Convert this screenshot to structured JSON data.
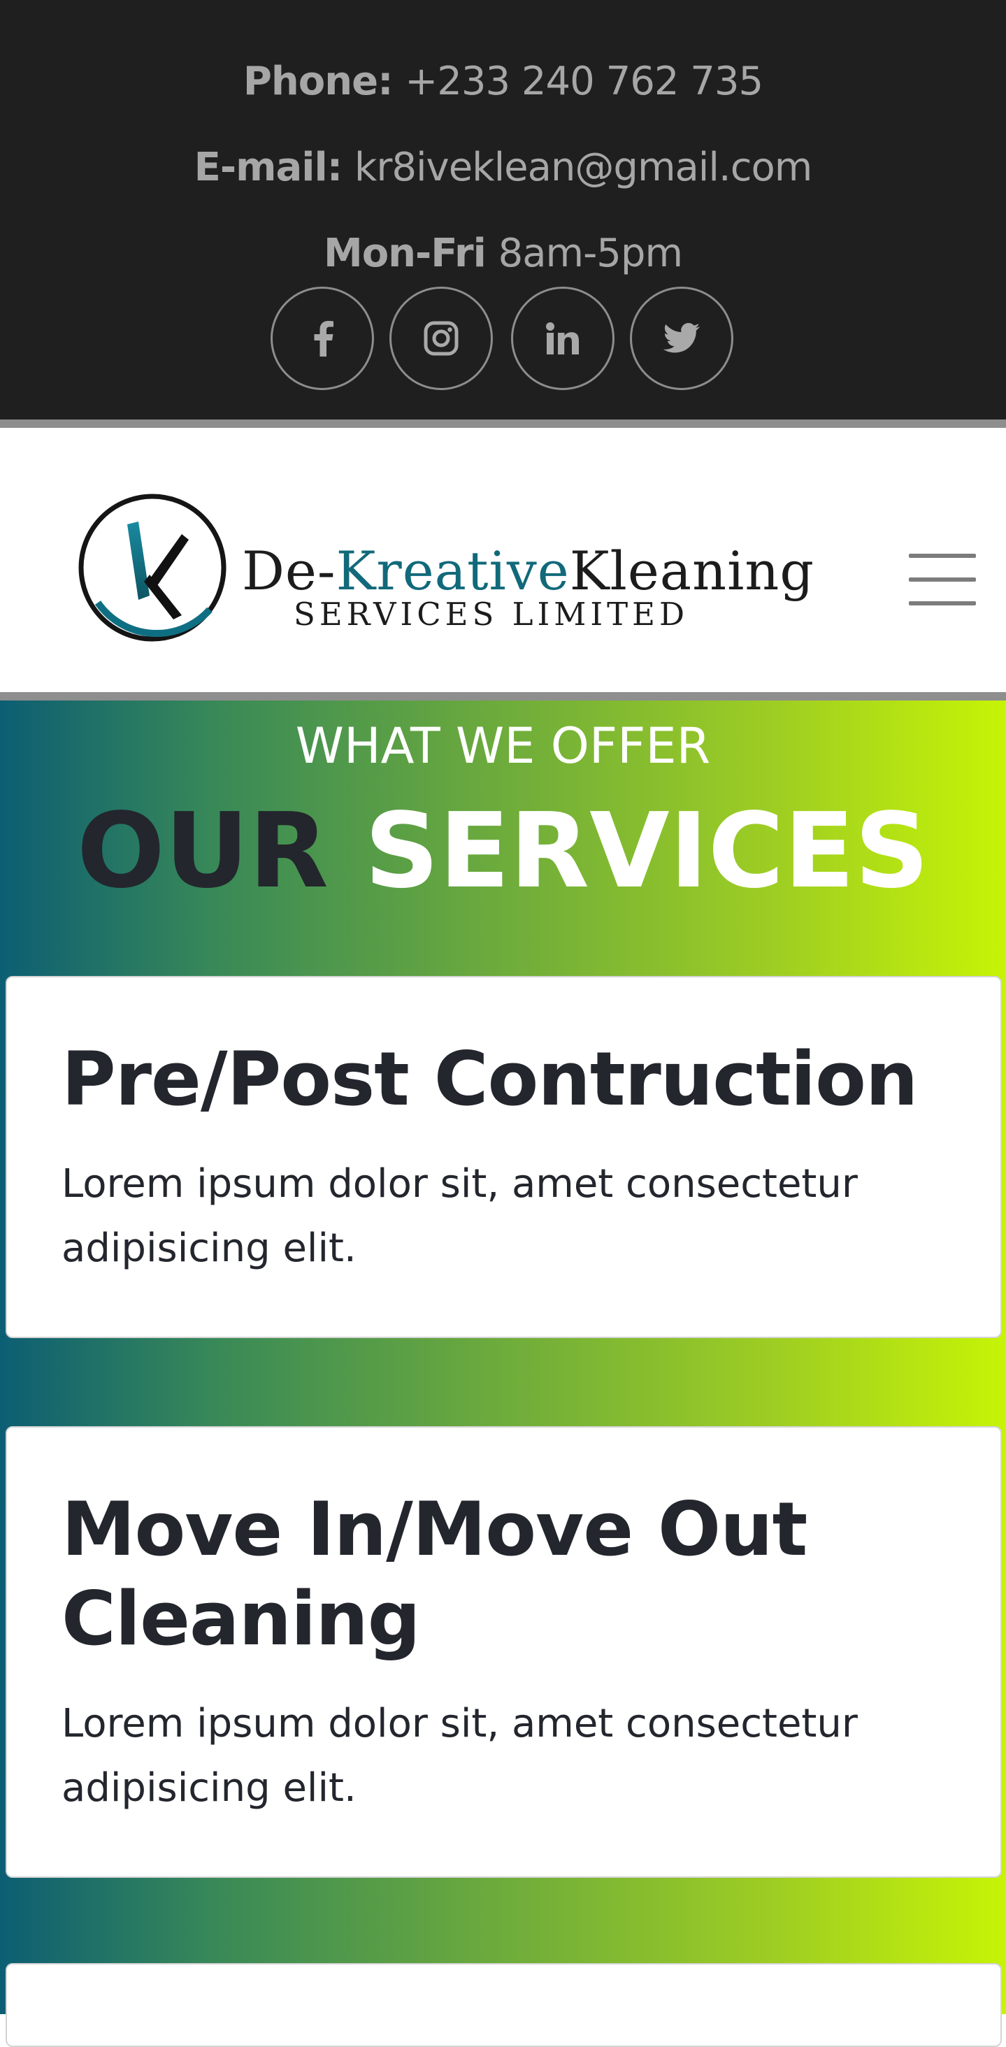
{
  "contact": {
    "phone_label": "Phone:",
    "phone_value": "+233 240 762 735",
    "email_label": "E-mail:",
    "email_value": "kr8iveklean@gmail.com",
    "hours_label": "Mon-Fri",
    "hours_value": "8am-5pm"
  },
  "social": {
    "icons": [
      "facebook-icon",
      "instagram-icon",
      "linkedin-icon",
      "twitter-icon"
    ],
    "icon_color": "#a9a9a9"
  },
  "logo": {
    "name_prefix": "De-",
    "name_accent": "Kreative",
    "name_suffix": "Kleaning",
    "tagline": "SERVICES LIMITED",
    "accent_color": "#11697a"
  },
  "menu": {
    "icon": "hamburger-menu-icon"
  },
  "services": {
    "eyebrow": "WHAT WE OFFER",
    "title_dark": "OUR",
    "title_light": "SERVICES",
    "gradient_start": "#0c5e73",
    "gradient_end": "#c6f406",
    "items": [
      {
        "title": "Pre/Post Contruction",
        "description": "Lorem ipsum dolor sit, amet consectetur adipisicing elit."
      },
      {
        "title": "Move In/Move Out Cleaning",
        "description": "Lorem ipsum dolor sit, amet consectetur adipisicing elit."
      }
    ]
  },
  "colors": {
    "topbar_bg": "#1f1f1f",
    "topbar_text": "#a6a6a6",
    "divider": "#8e8e8e",
    "heading_dark": "#23262d"
  }
}
